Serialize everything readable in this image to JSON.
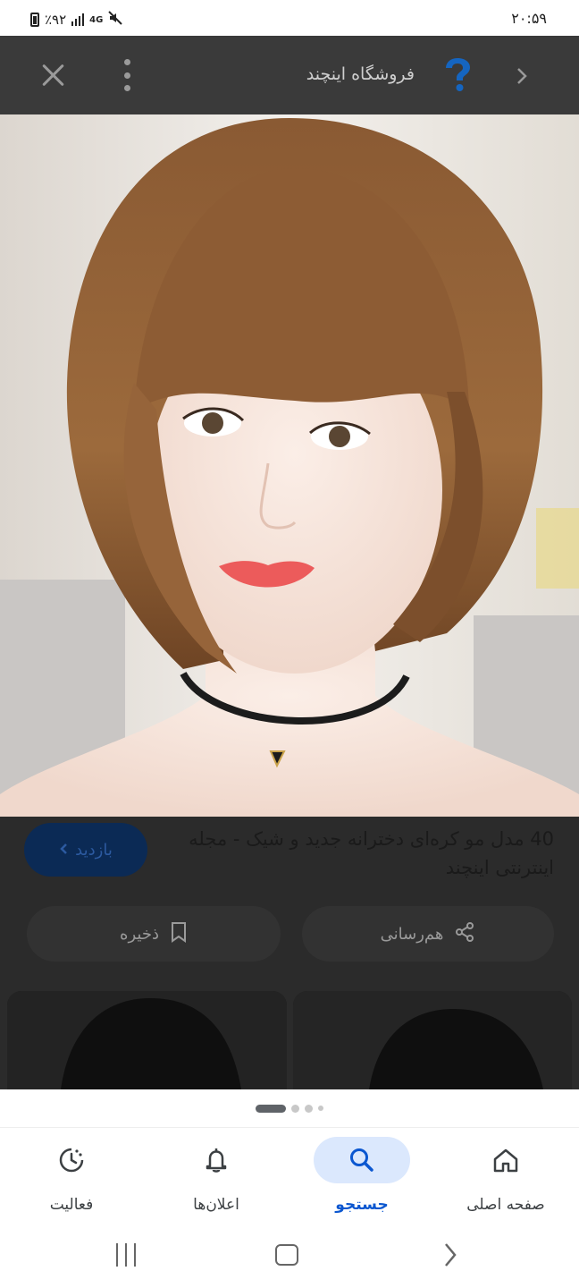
{
  "status_bar": {
    "battery": "٪۹۲",
    "network": "4G",
    "time": "۲۰:۵۹"
  },
  "top_bar": {
    "site_name": "فروشگاه اینچند",
    "close_icon": "close-icon",
    "more_icon": "more-vert-icon",
    "logo_icon": "question-pin-logo",
    "back_icon": "chevron-right-icon"
  },
  "result": {
    "title": "40 مدل مو کره‌ای دخترانه جدید و شیک - مجله اینترنتی اینچند",
    "visit_label": "بازدید",
    "share_label": "هم‌رسانی",
    "save_label": "ذخیره"
  },
  "pager": {
    "count": 4,
    "active": 0
  },
  "bottom_nav": {
    "items": [
      {
        "label": "صفحه اصلی",
        "icon": "home-icon",
        "active": false
      },
      {
        "label": "جستجو",
        "icon": "search-icon",
        "active": true
      },
      {
        "label": "اعلان‌ها",
        "icon": "bell-icon",
        "active": false
      },
      {
        "label": "فعالیت",
        "icon": "history-icon",
        "active": false
      }
    ]
  },
  "colors": {
    "accent": "#0b57d0",
    "active_pill": "#dbe8fd",
    "overlay": "#2b2b2b",
    "visit_button": "#0b2a55"
  }
}
